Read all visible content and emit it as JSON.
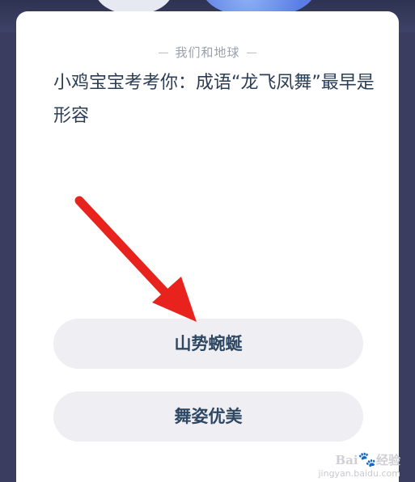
{
  "section": {
    "label": "我们和地球"
  },
  "question": {
    "text": "小鸡宝宝考考你：成语“龙飞凤舞”最早是形容"
  },
  "options": [
    {
      "label": "山势蜿蜒"
    },
    {
      "label": "舞姿优美"
    }
  ],
  "watermark": {
    "brand": "Bai",
    "brand2": "经验",
    "url": "jingyan.baidu.com"
  },
  "colors": {
    "background": "#3a3d5f",
    "card": "#ffffff",
    "option_bg": "#efeff3",
    "option_text": "#2e4762",
    "arrow": "#e8231d"
  },
  "icons": {
    "pointer": "red-arrow-icon",
    "watermark": "paw-icon"
  }
}
